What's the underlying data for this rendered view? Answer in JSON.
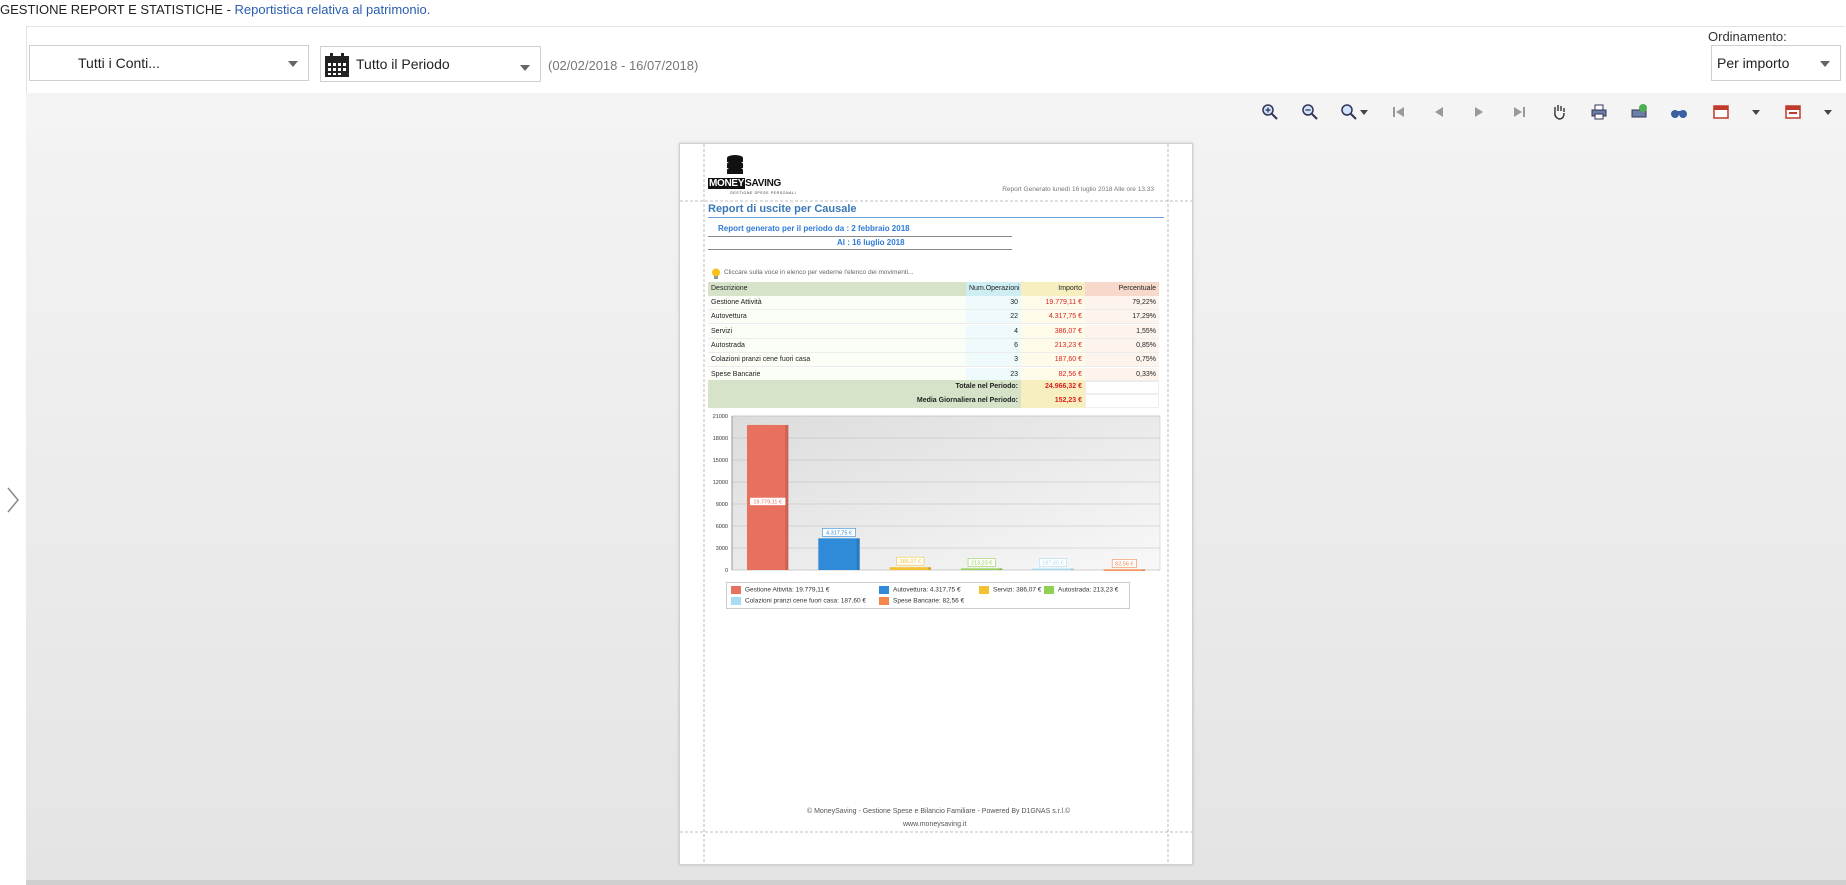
{
  "header": {
    "title": "GESTIONE REPORT E STATISTICHE",
    "separator": " - ",
    "subtitle": "Reportistica relativa al patrimonio."
  },
  "filters": {
    "accounts": "Tutti i Conti...",
    "period": "Tutto il Periodo",
    "date_range": "(02/02/2018 - 16/07/2018)",
    "ordering_label": "Ordinamento:",
    "ordering_value": "Per importo"
  },
  "toolbar_icons": [
    "zoom-in-icon",
    "zoom-out-icon",
    "zoom-dropdown-icon",
    "first-page-icon",
    "previous-page-icon",
    "next-page-icon",
    "last-page-icon",
    "pan-hand-icon",
    "print-icon",
    "page-setup-icon",
    "find-binoculars-icon",
    "export-icon",
    "export-dropdown-icon",
    "export-pdf-icon",
    "export-pdf-dropdown-icon"
  ],
  "report": {
    "logo_main_left": "MONEY",
    "logo_main_right": "SAVING",
    "logo_tagline": "GESTIONE SPESE PERSONALI",
    "generated_text": "Report Generato lunedì 16 luglio 2018 Alle ore 13.33",
    "title": "Report di uscite per Causale",
    "period_line1": "Report generato per il periodo da : 2 febbraio 2018",
    "period_line2": "Al : 16 luglio 2018",
    "hint": "Cliccare sulla voce in elenco per vederne l'elenco dei movimenti...",
    "columns": [
      "Descrizione",
      "Num.Operazioni",
      "Importo",
      "Percentuale"
    ],
    "rows": [
      {
        "desc": "Gestione Attività",
        "ops": "30",
        "amount": "19.779,11 €",
        "pct": "79,22%"
      },
      {
        "desc": "Autovettura",
        "ops": "22",
        "amount": "4.317,75 €",
        "pct": "17,29%"
      },
      {
        "desc": "Servizi",
        "ops": "4",
        "amount": "386,07 €",
        "pct": "1,55%"
      },
      {
        "desc": "Autostrada",
        "ops": "6",
        "amount": "213,23 €",
        "pct": "0,85%"
      },
      {
        "desc": "Colazioni pranzi cene fuori casa",
        "ops": "3",
        "amount": "187,60 €",
        "pct": "0,75%"
      },
      {
        "desc": "Spese Bancarie",
        "ops": "23",
        "amount": "82,56 €",
        "pct": "0,33%"
      }
    ],
    "total_label": "Totale nel Periodo:",
    "total_value": "24.966,32 €",
    "avg_label": "Media Giornaliera nel Periodo:",
    "avg_value": "152,23 €",
    "footer_line1": "© MoneySaving - Gestione Spese e Bilancio Familiare - Powered By D1GNAS s.r.l.©",
    "footer_line2": "www.moneysaving.it"
  },
  "chart_data": {
    "type": "bar",
    "categories": [
      "Gestione Attività",
      "Autovettura",
      "Servizi",
      "Autostrada",
      "Colazioni pranzi cene fuori casa",
      "Spese Bancarie"
    ],
    "values": [
      19779.11,
      4317.75,
      386.07,
      213.23,
      187.6,
      82.56
    ],
    "value_labels": [
      "19.779,11 €",
      "4.317,75 €",
      "386,07 €",
      "213,23 €",
      "187,60 €",
      "82,56 €"
    ],
    "legend_labels": [
      "Gestione Attività: 19.779,11 €",
      "Autovettura: 4.317,75 €",
      "Servizi: 386,07 €",
      "Autostrada: 213,23 €",
      "Colazioni pranzi cene fuori casa: 187,60 €",
      "Spese Bancarie: 82,56 €"
    ],
    "colors": [
      "#e8705f",
      "#2f8ad8",
      "#f2c234",
      "#8fcf52",
      "#a8dcf5",
      "#f4874b"
    ],
    "yticks": [
      0,
      3000,
      6000,
      9000,
      12000,
      15000,
      18000,
      21000
    ],
    "ylim": [
      0,
      21000
    ],
    "grid": true,
    "legend": "bottom"
  }
}
